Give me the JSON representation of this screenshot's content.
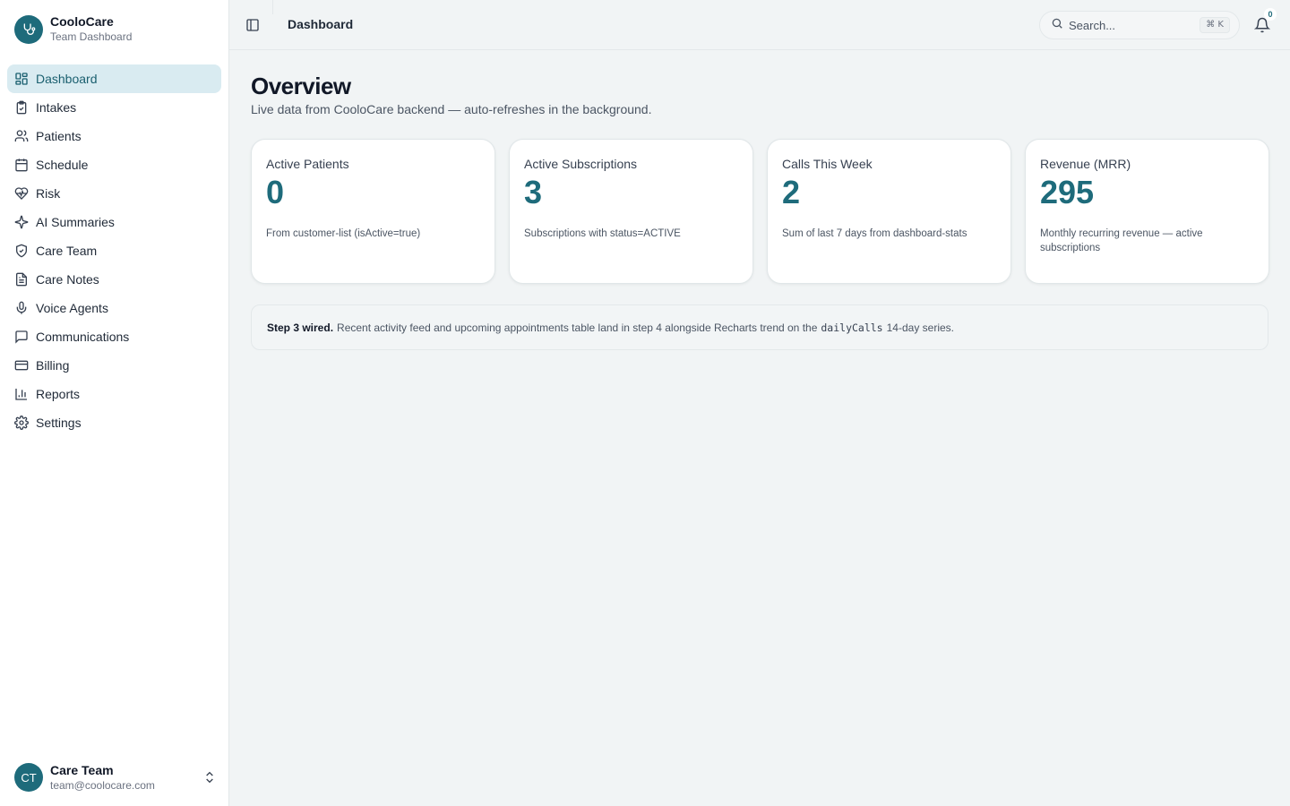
{
  "brand": {
    "name": "CooloCare",
    "subtitle": "Team Dashboard"
  },
  "sidebar": {
    "items": [
      {
        "label": "Dashboard",
        "icon": "dashboard-icon",
        "active": true
      },
      {
        "label": "Intakes",
        "icon": "clipboard-icon"
      },
      {
        "label": "Patients",
        "icon": "users-icon"
      },
      {
        "label": "Schedule",
        "icon": "calendar-icon"
      },
      {
        "label": "Risk",
        "icon": "heart-pulse-icon"
      },
      {
        "label": "AI Summaries",
        "icon": "sparkles-icon"
      },
      {
        "label": "Care Team",
        "icon": "shield-icon"
      },
      {
        "label": "Care Notes",
        "icon": "file-text-icon"
      },
      {
        "label": "Voice Agents",
        "icon": "microphone-icon"
      },
      {
        "label": "Communications",
        "icon": "message-icon"
      },
      {
        "label": "Billing",
        "icon": "credit-card-icon"
      },
      {
        "label": "Reports",
        "icon": "bar-chart-icon"
      },
      {
        "label": "Settings",
        "icon": "gear-icon"
      }
    ]
  },
  "user": {
    "initials": "CT",
    "name": "Care Team",
    "email": "team@coolocare.com"
  },
  "header": {
    "title": "Dashboard",
    "search_placeholder": "Search...",
    "search_shortcut": "⌘ K",
    "notification_count": "0"
  },
  "main": {
    "title": "Overview",
    "subtitle": "Live data from CooloCare backend — auto-refreshes in the background.",
    "cards": [
      {
        "label": "Active Patients",
        "value": "0",
        "note": "From customer-list (isActive=true)"
      },
      {
        "label": "Active Subscriptions",
        "value": "3",
        "note": "Subscriptions with status=ACTIVE"
      },
      {
        "label": "Calls This Week",
        "value": "2",
        "note": "Sum of last 7 days from dashboard-stats"
      },
      {
        "label": "Revenue (MRR)",
        "value": "295",
        "note": "Monthly recurring revenue — active subscriptions"
      }
    ],
    "notice": {
      "bold": "Step 3 wired.",
      "text_before": "Recent activity feed and upcoming appointments table land in step 4 alongside Recharts trend on the",
      "code": "dailyCalls",
      "text_after": "14-day series."
    }
  },
  "colors": {
    "accent": "#1e6b7b",
    "active_bg": "#d9ebf1",
    "background": "#f1f4f5"
  }
}
